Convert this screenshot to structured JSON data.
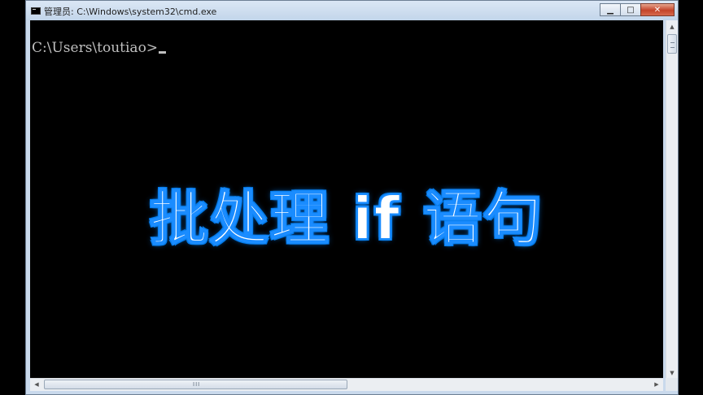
{
  "window": {
    "title": "管理员: C:\\Windows\\system32\\cmd.exe",
    "icon": "cmd-icon",
    "buttons": {
      "minimize": "▁",
      "maximize": "□",
      "close": "✕"
    }
  },
  "console": {
    "prompt": "C:\\Users\\toutiao>",
    "overlay_title": "批处理 if 语句"
  },
  "scrollbars": {
    "up_arrow": "▲",
    "down_arrow": "▼",
    "left_arrow": "◀",
    "right_arrow": "▶",
    "grip": "III"
  },
  "colors": {
    "console_bg": "#000000",
    "console_text": "#c0c0c0",
    "overlay_fill": "#ffffff",
    "overlay_outline": "#1a8cff"
  }
}
